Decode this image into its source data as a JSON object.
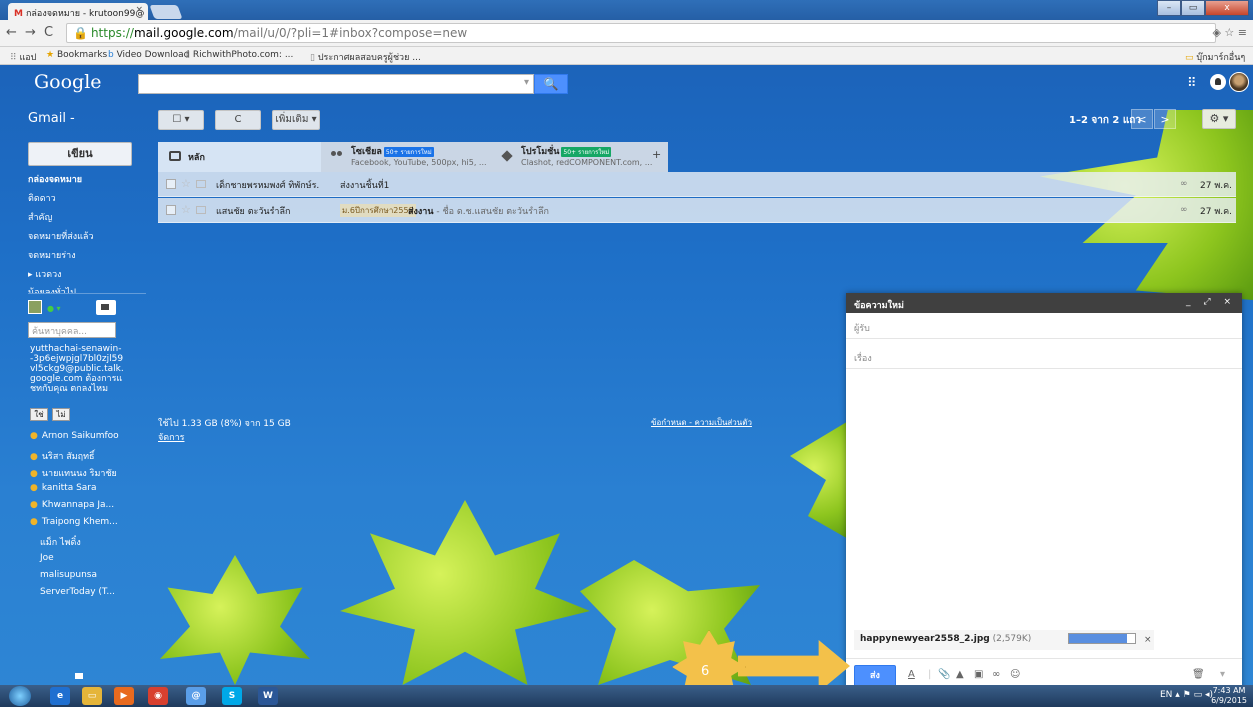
{
  "browser": {
    "tab_title": "กล่องจดหมาย - krutoon99@ ×",
    "tab_title_text": "กล่องจดหมาย - krutoon99@",
    "tab_close": "×",
    "url_https": "https://",
    "url_domain": "mail.google.com",
    "url_rest": "/mail/u/0/?pli=1#inbox?compose=new",
    "bookmarks": [
      "แอป",
      "Bookmarks",
      "Video Download",
      "RichwithPhoto.com: ...",
      "ประกาศผลสอบครูผู้ช่วย ..."
    ],
    "other_bookmarks": "บุ๊กมาร์กอื่นๆ"
  },
  "header": {
    "logo": "Google",
    "search_placeholder": "",
    "search_button": "🔍"
  },
  "toolbar": {
    "gmail_label": "Gmail -",
    "select_label": "☐ ▾",
    "refresh_label": "C",
    "more_label": "เพิ่มเติม ▾",
    "pager_text": "1–2 จาก 2 แถว",
    "prev": "<",
    "next": ">",
    "settings": "⚙ ▾"
  },
  "sidebar": {
    "compose_label": "เขียน",
    "items": [
      "กล่องจดหมาย",
      "ติดดาว",
      "สำคัญ",
      "จดหมายที่ส่งแล้ว",
      "จดหมายร่าง",
      "▸ แวดวง",
      "น้อยลงทั่วไป"
    ],
    "people_search_placeholder": "ค้นหาบุคคล...",
    "invite_text": "yutthachai-senawin--3p6ejwpjgl7bl0zjl59vl5ckg9@public.talk.google.com ต้องการแชทกับคุณ ตกลงไหม",
    "yes_label": "ใช่",
    "no_label": "ไม่",
    "contacts_online": [
      "Arnon Saikumfoo",
      "นริสา สัมฤทธิ์",
      "นายแทนนง ริมาชัย",
      "kanitta Sara",
      "Khwannapa Ja...",
      "Traipong Khem..."
    ],
    "contacts_offline": [
      "แม็ก ไพดิ๋ง",
      "Joe",
      "malisupunsa",
      "ServerToday (T..."
    ]
  },
  "inbox": {
    "tabs": [
      {
        "title": "หลัก",
        "sub": "",
        "badge": ""
      },
      {
        "title": "โซเชียล",
        "sub": "Facebook, YouTube, 500px, hi5, ...",
        "badge": "50+ รายการใหม่"
      },
      {
        "title": "โปรโมชั่น",
        "sub": "Clashot, redCOMPONENT.com, ...",
        "badge": "50+ รายการใหม่"
      }
    ],
    "add_tab": "+",
    "rows": [
      {
        "sender": "เด็กชายพรหมพงศ์ ทิพักษ์ร.",
        "label": "",
        "subject": "ส่งงานชิ้นที่1",
        "snippet": "",
        "date": "27 พ.ค."
      },
      {
        "sender": "แสนชัย ตะวันรำลึก",
        "label": "ม.6ปีการศึกษา2558",
        "subject": "ส่งงาน",
        "snippet": " - ชื่อ ด.ช.แสนชัย ตะวันรำลึก",
        "date": "27 พ.ค."
      }
    ],
    "storage_text": "ใช้ไป 1.33 GB (8%) จาก 15 GB",
    "storage_manage": "จัดการ",
    "footer_links": "ข้อกำหนด - ความเป็นส่วนตัว"
  },
  "compose": {
    "title": "ข้อความใหม่",
    "window_controls": "_ ⤢ ×",
    "to_placeholder": "ผู้รับ",
    "subject_placeholder": "เรื่อง",
    "attachment_name": "happynewyear2558_2.jpg",
    "attachment_size": " (2,579K)",
    "upload_progress": 0.88,
    "attachment_close": "×",
    "send_label": "ส่ง",
    "format_icon": "A",
    "attach_icon": "📎",
    "drive_icon": "▲",
    "photo_icon": "▣",
    "link_icon": "∞",
    "emoji_icon": "☺",
    "trash_icon": "🗑",
    "more_icon": "▾"
  },
  "annotation": {
    "step_number": "6",
    "color": "#f3c14a"
  },
  "taskbar": {
    "tray_lang": "EN",
    "time": "7:43 AM",
    "date": "6/9/2015"
  }
}
